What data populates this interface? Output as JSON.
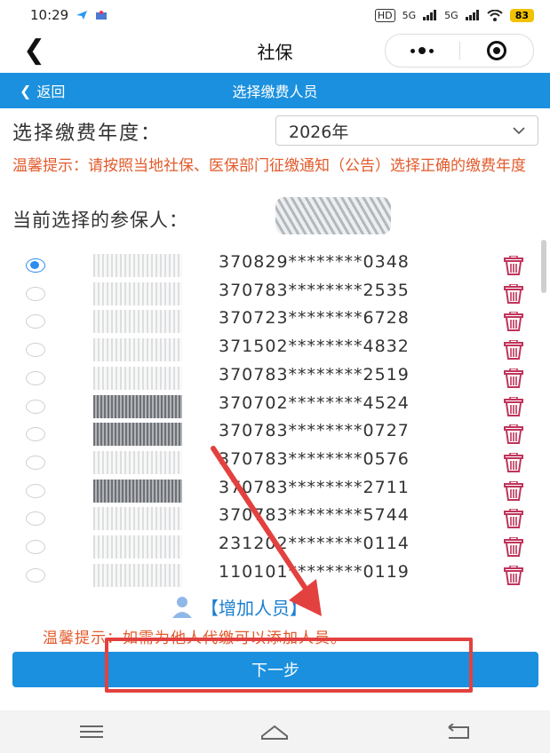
{
  "status": {
    "time": "10:29",
    "battery": "83",
    "signal1": "5G",
    "signal2": "5G",
    "hd": "HD"
  },
  "titlebar": {
    "title": "社保"
  },
  "header": {
    "back_label": "返回",
    "title": "选择缴费人员"
  },
  "year": {
    "label": "选择缴费年度：",
    "value": "2026年"
  },
  "notice": {
    "text": "温馨提示：请按照当地社保、医保部门征缴通知（公告）选择正确的缴费年度"
  },
  "current": {
    "label": "当前选择的参保人："
  },
  "people": [
    {
      "name_visible": "",
      "id": "370829********0348",
      "selected": true
    },
    {
      "name_visible": "",
      "id": "370783********2535",
      "selected": false
    },
    {
      "name_visible": "",
      "id": "370723********6728",
      "selected": false
    },
    {
      "name_visible": "",
      "id": "371502********4832",
      "selected": false
    },
    {
      "name_visible": "",
      "id": "370783********2519",
      "selected": false
    },
    {
      "name_visible": "",
      "id": "370702********4524",
      "selected": false
    },
    {
      "name_visible": "",
      "id": "370783********0727",
      "selected": false
    },
    {
      "name_visible": "",
      "id": "370783********0576",
      "selected": false
    },
    {
      "name_visible": "",
      "id": "370783********2711",
      "selected": false
    },
    {
      "name_visible": "",
      "id": "370783********5744",
      "selected": false
    },
    {
      "name_visible": "",
      "id": "231202********0114",
      "selected": false
    },
    {
      "name_visible": "",
      "id": "110101********0119",
      "selected": false
    }
  ],
  "add": {
    "label": "【增加人员】"
  },
  "tip2": {
    "text": "温馨提示：如需为他人代缴可以添加人员。"
  },
  "next": {
    "label": "下一步"
  },
  "colors": {
    "accent": "#1b90de",
    "warning": "#e25a2b",
    "trash": "#c0335a",
    "highlight": "#e2413f"
  }
}
